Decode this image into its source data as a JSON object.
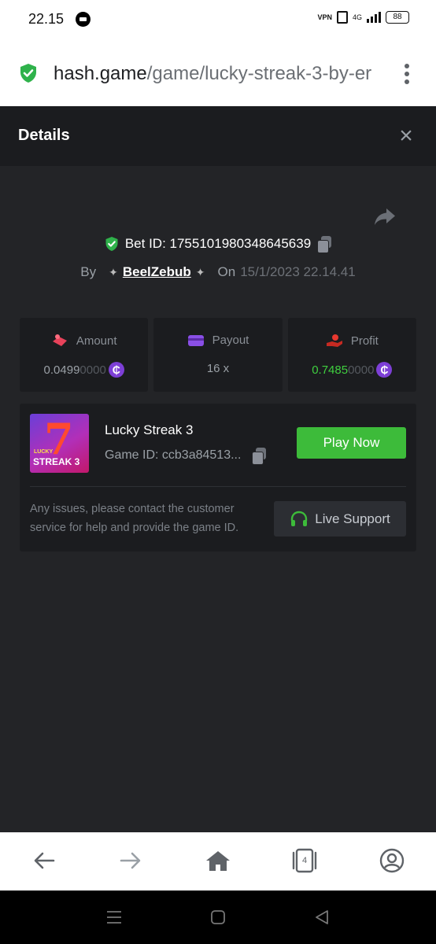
{
  "status_bar": {
    "time": "22.15",
    "vpn": "VPN",
    "network": "4G",
    "battery": "88"
  },
  "browser": {
    "url_domain": "hash.game",
    "url_path": "/game/lucky-streak-3-by-er"
  },
  "details": {
    "title": "Details",
    "close": "×",
    "bet_id": "Bet ID: 1755101980348645639",
    "by_label": "By",
    "user": "BeelZebub",
    "on_label": "On",
    "date": "15/1/2023 22.14.41"
  },
  "stats": {
    "amount": {
      "label": "Amount",
      "value": "0.0499",
      "zeros": "0000"
    },
    "payout": {
      "label": "Payout",
      "value": "16 x"
    },
    "profit": {
      "label": "Profit",
      "value": "0.7485",
      "zeros": "0000"
    },
    "coin_symbol": "₵"
  },
  "game": {
    "thumb_small": "LUCKY",
    "thumb_label": "STREAK 3",
    "title": "Lucky Streak 3",
    "game_id": "Game ID: ccb3a84513...",
    "play_label": "Play Now",
    "issue_text": "Any issues, please contact the customer service for help and provide the game ID.",
    "support_label": "Live Support"
  },
  "nav": {
    "tab_count": "4"
  },
  "colors": {
    "accent_green": "#3dbb3a",
    "profit_green": "#3fcf3f",
    "coin_purple": "#7d3fd6",
    "bg_dark": "#232427",
    "card_dark": "#1b1c1f"
  }
}
